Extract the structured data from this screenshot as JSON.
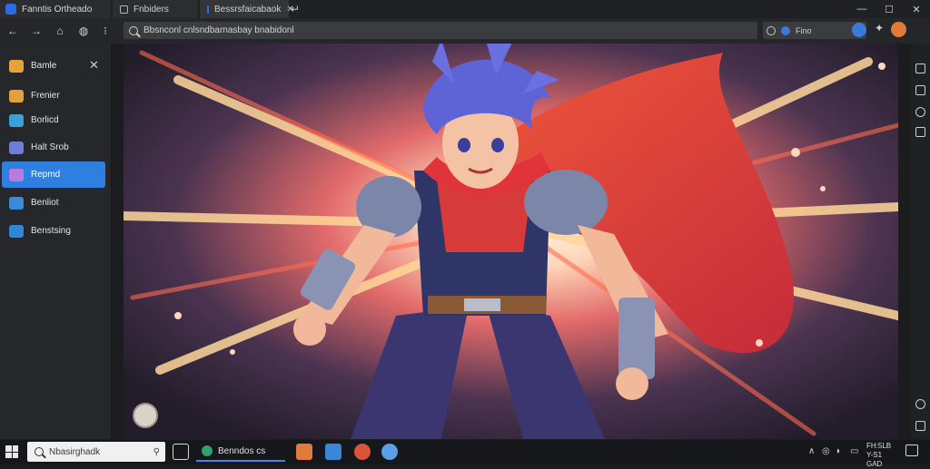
{
  "window": {
    "app_title": "Fanntis Ortheado",
    "tabs": [
      {
        "label": "Fnbiders"
      },
      {
        "label": "Bessrsfaicabaok"
      }
    ],
    "new_tab_icon": "new-tab-icon",
    "controls": {
      "minimize": "—",
      "maximize": "☐",
      "close": "✕"
    }
  },
  "toolbar": {
    "address": "Bbsnconl cnlsndbarnasbay bnabidonl",
    "extension_label": "Fino"
  },
  "sidebar": {
    "items": [
      {
        "label": "Bamle",
        "color": "#e8a23a",
        "active": false
      },
      {
        "label": "Frenier",
        "color": "#e3a13a",
        "active": false
      },
      {
        "label": "Borlicd",
        "color": "#3ba0d8",
        "active": false
      },
      {
        "label": "Halt Srob",
        "color": "#6b7fd6",
        "active": false
      },
      {
        "label": "Repmd",
        "color": "#b97be0",
        "active": true
      },
      {
        "label": "Benliot",
        "color": "#3b8ad8",
        "active": false
      },
      {
        "label": "Benstsing",
        "color": "#2f86d6",
        "active": false
      }
    ]
  },
  "taskbar": {
    "search_placeholder": "Nbasirghadk",
    "running_app_label": "Benndos cs",
    "clock_time": "FH:5LB",
    "clock_date": "Y-S1 GAD"
  },
  "colors": {
    "accent": "#2f7fe0",
    "sidebar_bg": "#26272a",
    "taskbar_bg": "#15171b"
  }
}
